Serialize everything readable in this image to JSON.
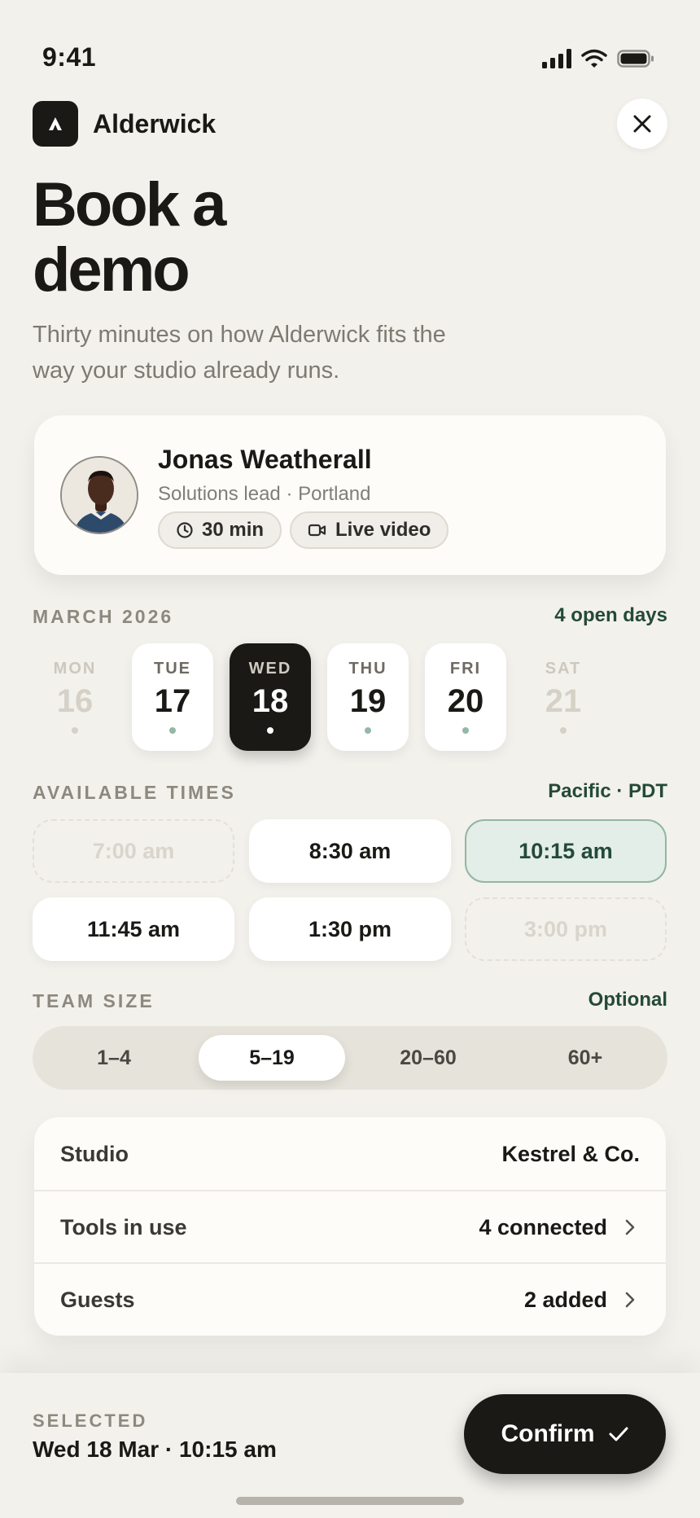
{
  "status_bar": {
    "time": "9:41"
  },
  "header": {
    "brand": "Alderwick"
  },
  "page": {
    "title": "Book a demo",
    "subtitle": "Thirty minutes on how Alderwick fits the way your studio already runs."
  },
  "host": {
    "name": "Jonas Weatherall",
    "role": "Solutions lead · Portland",
    "duration": "30 min",
    "format": "Live video"
  },
  "calendar": {
    "month": "MARCH 2026",
    "open_days": "4 open days",
    "days": [
      {
        "dow": "MON",
        "num": "16",
        "state": "unavailable"
      },
      {
        "dow": "TUE",
        "num": "17",
        "state": "available"
      },
      {
        "dow": "WED",
        "num": "18",
        "state": "selected"
      },
      {
        "dow": "THU",
        "num": "19",
        "state": "available"
      },
      {
        "dow": "FRI",
        "num": "20",
        "state": "available"
      },
      {
        "dow": "SAT",
        "num": "21",
        "state": "unavailable"
      }
    ]
  },
  "times": {
    "label": "AVAILABLE TIMES",
    "timezone": "Pacific · PDT",
    "slots": [
      {
        "time": "7:00 am",
        "state": "unavailable"
      },
      {
        "time": "8:30 am",
        "state": "available"
      },
      {
        "time": "10:15 am",
        "state": "selected"
      },
      {
        "time": "11:45 am",
        "state": "available"
      },
      {
        "time": "1:30 pm",
        "state": "available"
      },
      {
        "time": "3:00 pm",
        "state": "unavailable"
      }
    ]
  },
  "team_size": {
    "label": "TEAM SIZE",
    "hint": "Optional",
    "options": [
      "1–4",
      "5–19",
      "20–60",
      "60+"
    ],
    "selected": "5–19"
  },
  "details": [
    {
      "label": "Studio",
      "value": "Kestrel & Co."
    },
    {
      "label": "Tools in use",
      "value": "4 connected"
    },
    {
      "label": "Guests",
      "value": "2 added"
    }
  ],
  "footer": {
    "selected_label": "SELECTED",
    "selected_value": "Wed 18 Mar · 10:15 am",
    "confirm_label": "Confirm"
  },
  "colors": {
    "background": "#F3F1EC",
    "ink": "#1A1916",
    "accent_green": "#244A37",
    "selected_slot_bg": "#E2EEE7"
  }
}
